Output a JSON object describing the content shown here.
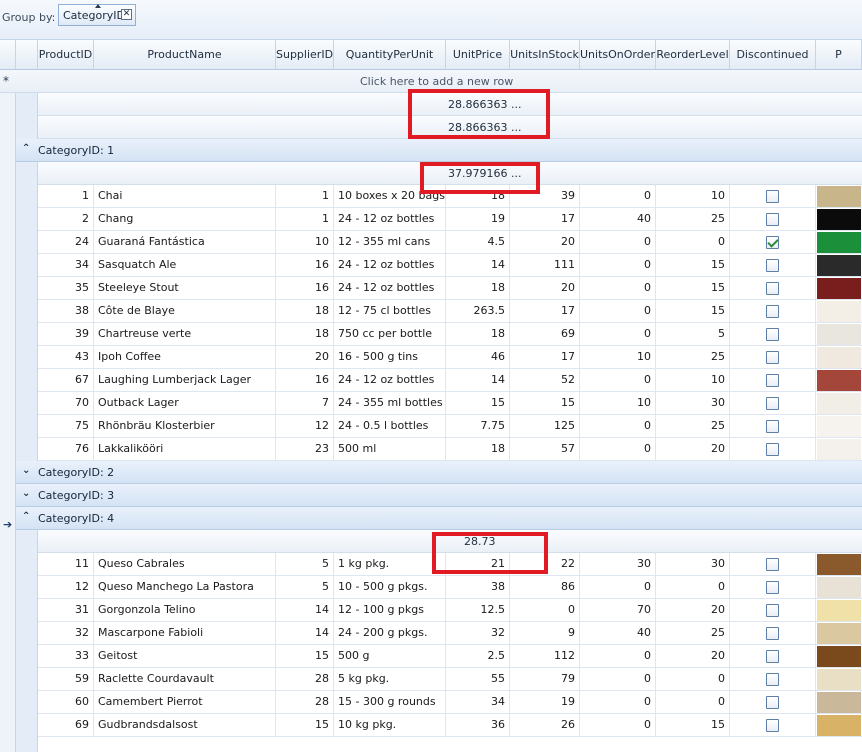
{
  "group_panel": {
    "label": "Group by:",
    "chip": "CategoryID"
  },
  "columns": [
    "ProductID",
    "ProductName",
    "SupplierID",
    "QuantityPerUnit",
    "UnitPrice",
    "UnitsInStock",
    "UnitsOnOrder",
    "ReorderLevel",
    "Discontinued",
    "P"
  ],
  "add_row": {
    "symbol": "*",
    "text": "Click here to add a new row"
  },
  "summary_rows": [
    "28.866363 ...",
    "28.866363 ..."
  ],
  "groups": [
    {
      "label": "CategoryID: 1",
      "expanded": true,
      "aggregate": "37.979166 ...",
      "rows": [
        {
          "id": "1",
          "name": "Chai",
          "supplier": "1",
          "qty": "10 boxes x 20 bags",
          "price": "18",
          "stock": "39",
          "order": "0",
          "reorder": "10",
          "disc": false,
          "img": "#c9b58a"
        },
        {
          "id": "2",
          "name": "Chang",
          "supplier": "1",
          "qty": "24 - 12 oz bottles",
          "price": "19",
          "stock": "17",
          "order": "40",
          "reorder": "25",
          "disc": false,
          "img": "#0b0b0b"
        },
        {
          "id": "24",
          "name": "Guaraná Fantástica",
          "supplier": "10",
          "qty": "12 - 355 ml cans",
          "price": "4.5",
          "stock": "20",
          "order": "0",
          "reorder": "0",
          "disc": true,
          "img": "#1c8f3a"
        },
        {
          "id": "34",
          "name": "Sasquatch Ale",
          "supplier": "16",
          "qty": "24 - 12 oz bottles",
          "price": "14",
          "stock": "111",
          "order": "0",
          "reorder": "15",
          "disc": false,
          "img": "#2a2a2a"
        },
        {
          "id": "35",
          "name": "Steeleye Stout",
          "supplier": "16",
          "qty": "24 - 12 oz bottles",
          "price": "18",
          "stock": "20",
          "order": "0",
          "reorder": "15",
          "disc": false,
          "img": "#7a1d1d"
        },
        {
          "id": "38",
          "name": "Côte de Blaye",
          "supplier": "18",
          "qty": "12 - 75 cl bottles",
          "price": "263.5",
          "stock": "17",
          "order": "0",
          "reorder": "15",
          "disc": false,
          "img": "#f3eee6"
        },
        {
          "id": "39",
          "name": "Chartreuse verte",
          "supplier": "18",
          "qty": "750 cc per bottle",
          "price": "18",
          "stock": "69",
          "order": "0",
          "reorder": "5",
          "disc": false,
          "img": "#e9e6df"
        },
        {
          "id": "43",
          "name": "Ipoh Coffee",
          "supplier": "20",
          "qty": "16 - 500 g tins",
          "price": "46",
          "stock": "17",
          "order": "10",
          "reorder": "25",
          "disc": false,
          "img": "#efe9e0"
        },
        {
          "id": "67",
          "name": "Laughing Lumberjack Lager",
          "supplier": "16",
          "qty": "24 - 12 oz bottles",
          "price": "14",
          "stock": "52",
          "order": "0",
          "reorder": "10",
          "disc": false,
          "img": "#a4463a"
        },
        {
          "id": "70",
          "name": "Outback Lager",
          "supplier": "7",
          "qty": "24 - 355 ml bottles",
          "price": "15",
          "stock": "15",
          "order": "10",
          "reorder": "30",
          "disc": false,
          "img": "#f1ede7"
        },
        {
          "id": "75",
          "name": "Rhönbräu Klosterbier",
          "supplier": "12",
          "qty": "24 - 0.5 l bottles",
          "price": "7.75",
          "stock": "125",
          "order": "0",
          "reorder": "25",
          "disc": false,
          "img": "#f6f3ee"
        },
        {
          "id": "76",
          "name": "Lakkalikööri",
          "supplier": "23",
          "qty": "500 ml",
          "price": "18",
          "stock": "57",
          "order": "0",
          "reorder": "20",
          "disc": false,
          "img": "#f4f1ec"
        }
      ]
    },
    {
      "label": "CategoryID: 2",
      "expanded": false
    },
    {
      "label": "CategoryID: 3",
      "expanded": false
    },
    {
      "label": "CategoryID: 4",
      "expanded": true,
      "aggregate": "28.73",
      "rows": [
        {
          "id": "11",
          "name": "Queso Cabrales",
          "supplier": "5",
          "qty": "1 kg pkg.",
          "price": "21",
          "stock": "22",
          "order": "30",
          "reorder": "30",
          "disc": false,
          "img": "#8a5a2c"
        },
        {
          "id": "12",
          "name": "Queso Manchego La Pastora",
          "supplier": "5",
          "qty": "10 - 500 g pkgs.",
          "price": "38",
          "stock": "86",
          "order": "0",
          "reorder": "0",
          "disc": false,
          "img": "#e8e2d6"
        },
        {
          "id": "31",
          "name": "Gorgonzola Telino",
          "supplier": "14",
          "qty": "12 - 100 g pkgs",
          "price": "12.5",
          "stock": "0",
          "order": "70",
          "reorder": "20",
          "disc": false,
          "img": "#efe1a8"
        },
        {
          "id": "32",
          "name": "Mascarpone Fabioli",
          "supplier": "14",
          "qty": "24 - 200 g pkgs.",
          "price": "32",
          "stock": "9",
          "order": "40",
          "reorder": "25",
          "disc": false,
          "img": "#d9c8a0"
        },
        {
          "id": "33",
          "name": "Geitost",
          "supplier": "15",
          "qty": "500 g",
          "price": "2.5",
          "stock": "112",
          "order": "0",
          "reorder": "20",
          "disc": false,
          "img": "#7a4a1c"
        },
        {
          "id": "59",
          "name": "Raclette Courdavault",
          "supplier": "28",
          "qty": "5 kg pkg.",
          "price": "55",
          "stock": "79",
          "order": "0",
          "reorder": "0",
          "disc": false,
          "img": "#e9dfc4"
        },
        {
          "id": "60",
          "name": "Camembert Pierrot",
          "supplier": "28",
          "qty": "15 - 300 g rounds",
          "price": "34",
          "stock": "19",
          "order": "0",
          "reorder": "0",
          "disc": false,
          "img": "#c9b99a"
        },
        {
          "id": "69",
          "name": "Gudbrandsdalsost",
          "supplier": "15",
          "qty": "10 kg pkg.",
          "price": "36",
          "stock": "26",
          "order": "0",
          "reorder": "15",
          "disc": false,
          "img": "#d7b267"
        }
      ]
    }
  ]
}
